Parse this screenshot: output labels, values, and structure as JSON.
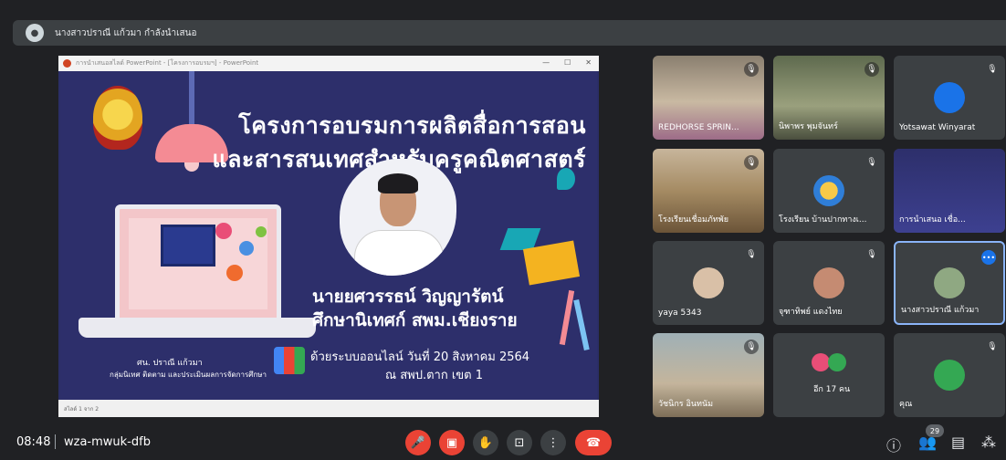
{
  "presenter_bar": {
    "text": "นางสาวปราณี แก้วมา กำลังนำเสนอ"
  },
  "ppt_window": {
    "title": "การนำเสนอสไลด์ PowerPoint - [โครงการอบรมฯ] - PowerPoint",
    "status": "สไลด์ 1 จาก 2"
  },
  "slide": {
    "title_line1": "โครงการอบรมการผลิตสื่อการสอน",
    "title_line2": "และสารสนเทศสำหรับครูคณิตศาสตร์",
    "presenter_name": "นายยศวรรธน์  วิญญารัตน์",
    "presenter_role": "ศึกษานิเทศก์ สพม.เชียงราย",
    "online_date": "ด้วยระบบออนไลน์  วันที่ 20 สิงหาคม 2564",
    "location": "ณ สพป.ตาก เขต 1",
    "credit_line1": "ศน. ปราณี  แก้วมา",
    "credit_line2": "กลุ่มนิเทศ ติดตาม และประเมินผลการจัดการศึกษา"
  },
  "participants": [
    {
      "name": "REDHORSE SPRIN...",
      "mic": "muted"
    },
    {
      "name": "นิพาพร พุมจันทร์",
      "mic": "muted"
    },
    {
      "name": "Yotsawat Winyarat",
      "mic": "muted"
    },
    {
      "name": "โรงเรียนเชื่อมภัทพัย",
      "mic": "muted"
    },
    {
      "name": "โรงเรียน บ้านปากทางเ...",
      "mic": "muted"
    },
    {
      "name": "การนำเสนอ เชื่อ...",
      "mic": "none"
    },
    {
      "name": "yaya 5343",
      "mic": "muted"
    },
    {
      "name": "จุฑาทิพย์ แดงไทย",
      "mic": "muted"
    },
    {
      "name": "นางสาวปราณี แก้วมา",
      "mic": "speaking"
    },
    {
      "name": "วัชนิกร อินทนัม",
      "mic": "muted"
    },
    {
      "name": "อีก 17 คน",
      "mic": "none"
    },
    {
      "name": "คุณ",
      "mic": "muted"
    }
  ],
  "toolbar": {
    "time": "08:48",
    "meeting_code": "wza-mwuk-dfb",
    "participant_count": "29",
    "icons": [
      "mic-off-icon",
      "camera-off-icon",
      "raise-hand-icon",
      "present-icon",
      "more-icon",
      "end-call-icon",
      "info-icon",
      "people-icon",
      "chat-icon",
      "activities-icon"
    ]
  },
  "colors": {
    "background": "#202124",
    "tile": "#3c4043",
    "danger": "#ea4335",
    "slide_bg": "#2d2f6b",
    "active_border": "#8ab4f8"
  }
}
